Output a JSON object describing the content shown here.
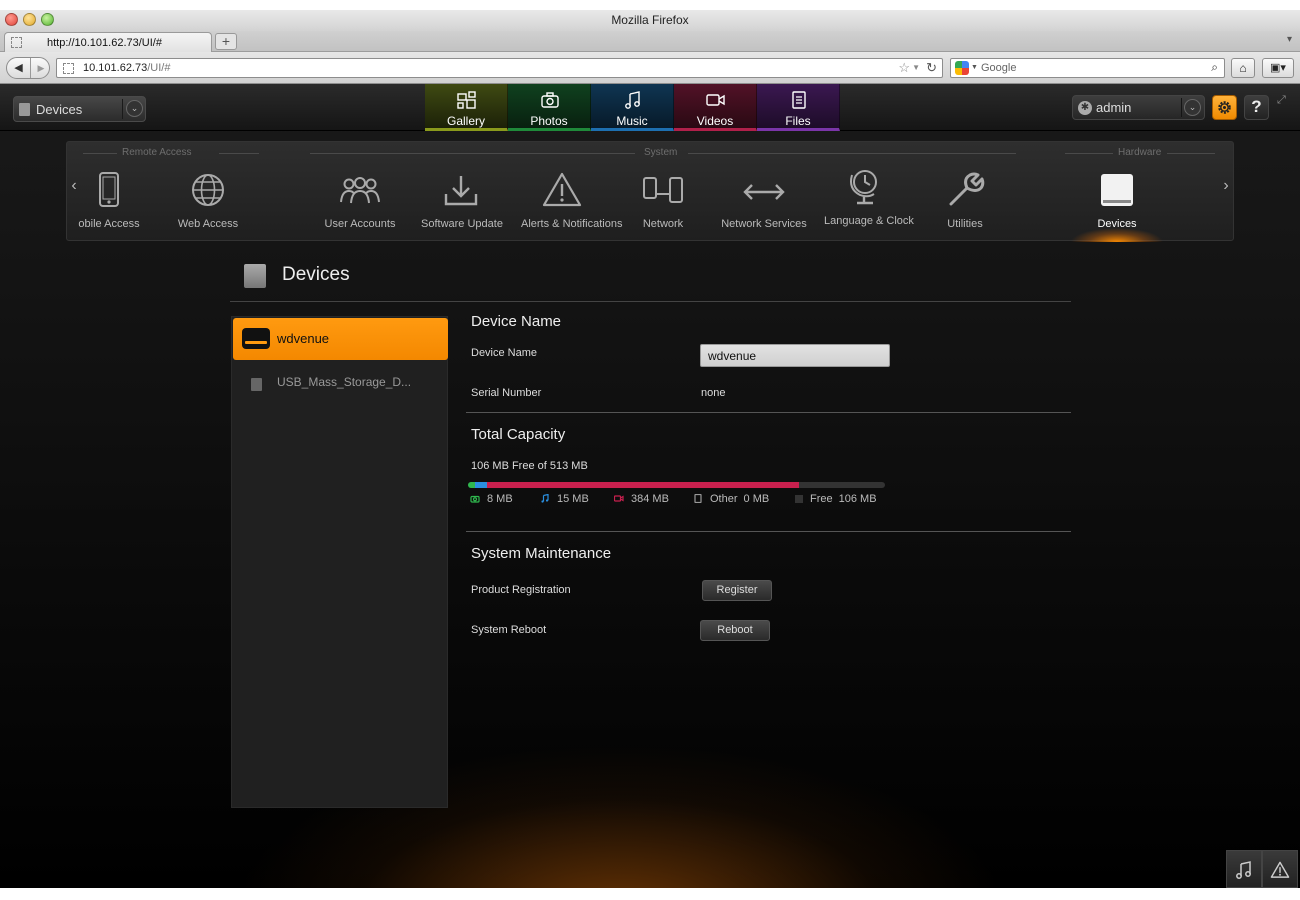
{
  "browser": {
    "window_title": "Mozilla Firefox",
    "tab_label": "http://10.101.62.73/UI/#",
    "url_host": "10.101.62.73",
    "url_path": "/UI/#",
    "search_placeholder": "Google",
    "new_tab_label": "+"
  },
  "app": {
    "context_dropdown": "Devices",
    "media_tabs": [
      {
        "label": "Gallery",
        "icon": "gallery-icon"
      },
      {
        "label": "Photos",
        "icon": "camera-icon"
      },
      {
        "label": "Music",
        "icon": "music-note-icon"
      },
      {
        "label": "Videos",
        "icon": "video-camera-icon"
      },
      {
        "label": "Files",
        "icon": "document-icon"
      }
    ],
    "user": "admin",
    "help_label": "?",
    "accent_color": "#f48800"
  },
  "ribbon": {
    "categories": [
      "Remote Access",
      "System",
      "Hardware"
    ],
    "items": [
      {
        "label": "obile Access",
        "icon": "smartphone-icon"
      },
      {
        "label": "Web Access",
        "icon": "globe-icon"
      },
      {
        "label": "User Accounts",
        "icon": "users-icon"
      },
      {
        "label": "Software Update",
        "icon": "download-icon"
      },
      {
        "label": "Alerts & Notifications",
        "icon": "warning-icon"
      },
      {
        "label": "Network",
        "icon": "network-icon"
      },
      {
        "label": "Network Services",
        "icon": "two-way-arrow-icon"
      },
      {
        "label": "Language & Clock",
        "icon": "globe-clock-icon"
      },
      {
        "label": "Utilities",
        "icon": "wrench-icon"
      },
      {
        "label": "Devices",
        "icon": "drive-icon",
        "active": true
      }
    ]
  },
  "page": {
    "title": "Devices"
  },
  "devices": [
    {
      "name": "wdvenue",
      "selected": true
    },
    {
      "name": "USB_Mass_Storage_D...",
      "selected": false
    }
  ],
  "device_name_section": {
    "title": "Device Name",
    "name_label": "Device Name",
    "name_value": "wdvenue",
    "serial_label": "Serial Number",
    "serial_value": "none"
  },
  "capacity_section": {
    "title": "Total Capacity",
    "summary": "106 MB Free of 513 MB",
    "total_mb": 513,
    "segments": [
      {
        "type": "photos",
        "icon": "camera-icon",
        "value": "8 MB",
        "mb": 8,
        "color": "#2fb84e"
      },
      {
        "type": "music",
        "icon": "music-note-icon",
        "value": "15 MB",
        "mb": 15,
        "color": "#2a8fe0"
      },
      {
        "type": "videos",
        "icon": "video-camera-icon",
        "value": "384 MB",
        "mb": 384,
        "color": "#c8204e"
      },
      {
        "type": "other",
        "icon": "document-icon",
        "name": "Other",
        "value": "0 MB",
        "mb": 0,
        "color": "#888888"
      },
      {
        "type": "free",
        "icon": "free-square-icon",
        "name": "Free",
        "value": "106 MB",
        "mb": 106,
        "color": "#333333"
      }
    ]
  },
  "maintenance_section": {
    "title": "System Maintenance",
    "registration_label": "Product Registration",
    "register_button": "Register",
    "reboot_label": "System Reboot",
    "reboot_button": "Reboot"
  }
}
